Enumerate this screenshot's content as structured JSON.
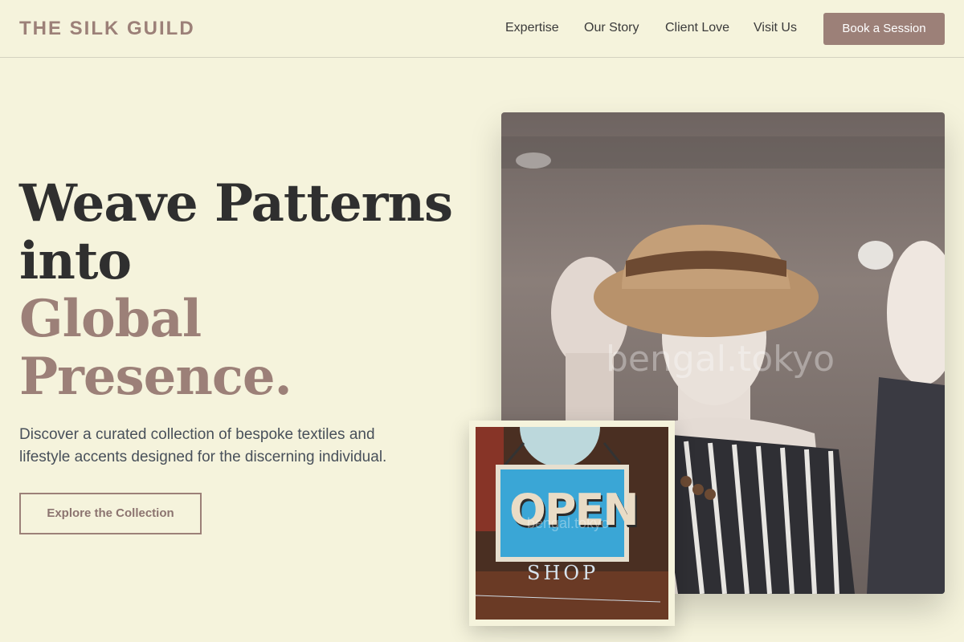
{
  "header": {
    "brand": "THE SILK GUILD",
    "nav": [
      "Expertise",
      "Our Story",
      "Client Love",
      "Visit Us"
    ],
    "cta": "Book a Session"
  },
  "hero": {
    "headline_dark_1": "Weave Patterns",
    "headline_dark_2": "into",
    "headline_accent_1": "Global",
    "headline_accent_2": "Presence.",
    "subtitle": "Discover a curated collection of bespoke textiles and lifestyle accents designed for the discerning individual.",
    "button": "Explore the Collection"
  },
  "images": {
    "main_watermark": "bengal.tokyo",
    "small_sign_text": "OPEN",
    "small_sign_sub": "SHOP",
    "small_watermark": "bengal.tokyo"
  },
  "colors": {
    "background": "#f5f3dc",
    "accent": "#9c8078",
    "text_dark": "#2f2f2f"
  }
}
